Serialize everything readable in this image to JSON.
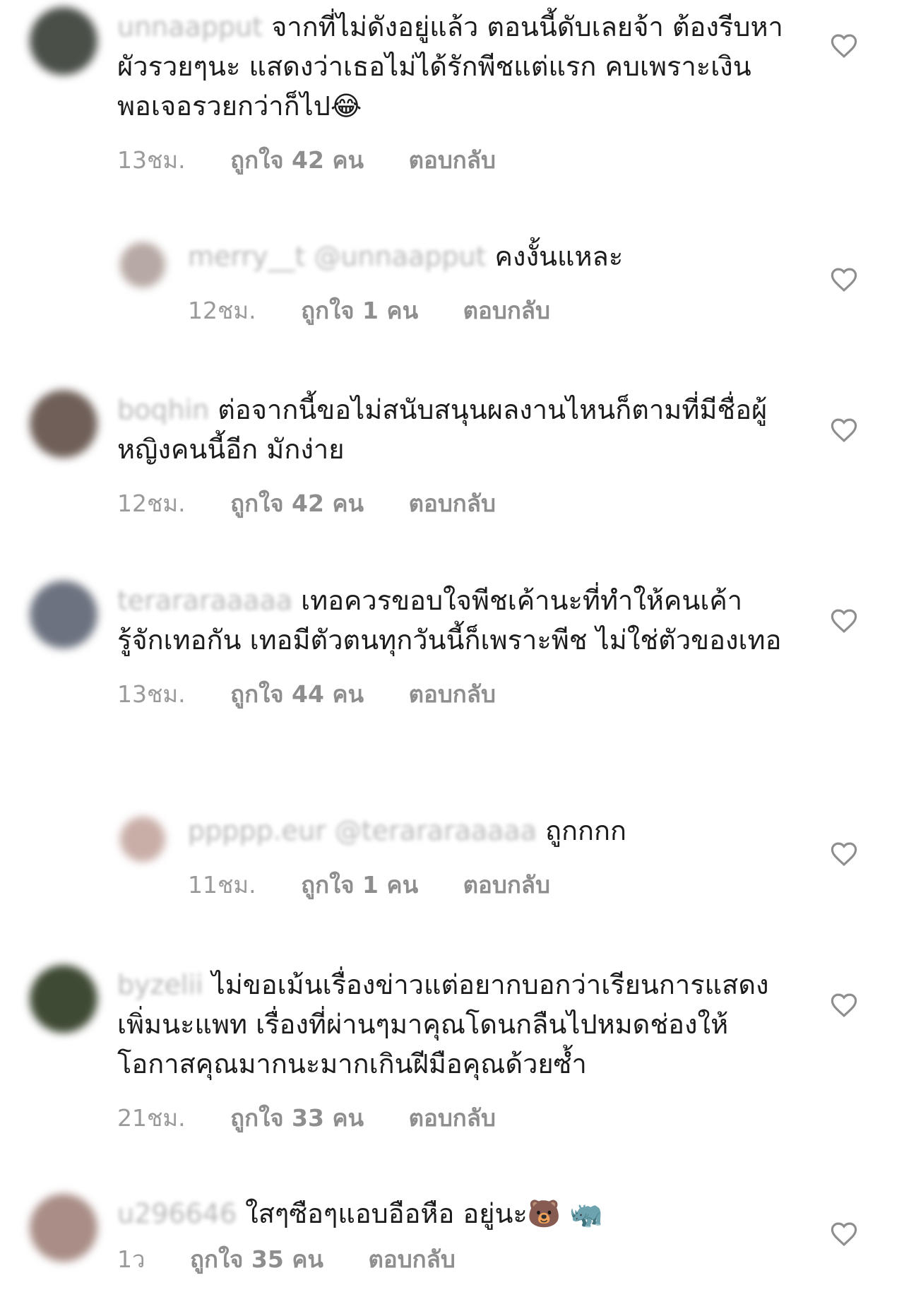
{
  "comments": [
    {
      "username": "unnaapput",
      "text": "จากที่ไม่ดังอยู่แล้ว ตอนนี้ดับเลยจ้า ต้องรีบหาผัวรวยๆนะ แสดงว่าเธอไม่ได้รักพีชแต่แรก คบเพราะเงิน พอเจอรวยกว่าก็ไป😂",
      "time": "13ชม.",
      "likes": "ถูกใจ 42 คน",
      "reply_label": "ตอบกลับ",
      "avatar_color": "#4a4f48"
    },
    {
      "username": "merry__t @unnaapput",
      "text": "คงงั้นแหละ",
      "time": "12ชม.",
      "likes": "ถูกใจ 1 คน",
      "reply_label": "ตอบกลับ",
      "avatar_color": "#b7a9a4"
    },
    {
      "username": "boqhin",
      "text": "ต่อจากนี้ขอไม่สนับสนุนผลงานไหนก็ตามที่มีชื่อผู้หญิงคนนี้อีก มักง่าย",
      "time": "12ชม.",
      "likes": "ถูกใจ 42 คน",
      "reply_label": "ตอบกลับ",
      "avatar_color": "#6f5f58"
    },
    {
      "username": "terararaaaaa",
      "text": "เทอควรขอบใจพีชเค้านะที่ทำให้คนเค้ารู้จักเทอกัน เทอมีตัวตนทุกวันนี้ก็เพราะพีช ไม่ใช่ตัวของเทอ",
      "time": "13ชม.",
      "likes": "ถูกใจ 44 คน",
      "reply_label": "ตอบกลับ",
      "avatar_color": "#6c7380"
    },
    {
      "username": "ppppp.eur @terararaaaaa",
      "text": "ถูกกกก",
      "time": "11ชม.",
      "likes": "ถูกใจ 1 คน",
      "reply_label": "ตอบกลับ",
      "avatar_color": "#c9aea8"
    },
    {
      "username": "byzelii",
      "text": "ไม่ขอเม้นเรื่องข่าวแต่อยากบอกว่าเรียนการแสดงเพิ่มนะแพท เรื่องที่ผ่านๆมาคุณโดนกลืนไปหมดช่องให้โอกาสคุณมากนะมากเกินฝีมือคุณด้วยซ้ำ",
      "time": "21ชม.",
      "likes": "ถูกใจ 33 คน",
      "reply_label": "ตอบกลับ",
      "avatar_color": "#3e4a34"
    },
    {
      "username": "u296646",
      "text": "ใสๆซือๆแอบอือหือ อยู่นะ🐻 🦏",
      "time": "1ว",
      "likes": "ถูกใจ 35 คน",
      "reply_label": "ตอบกลับ",
      "avatar_color": "#a98d86"
    }
  ],
  "heart_icon": "heart-outline-icon"
}
